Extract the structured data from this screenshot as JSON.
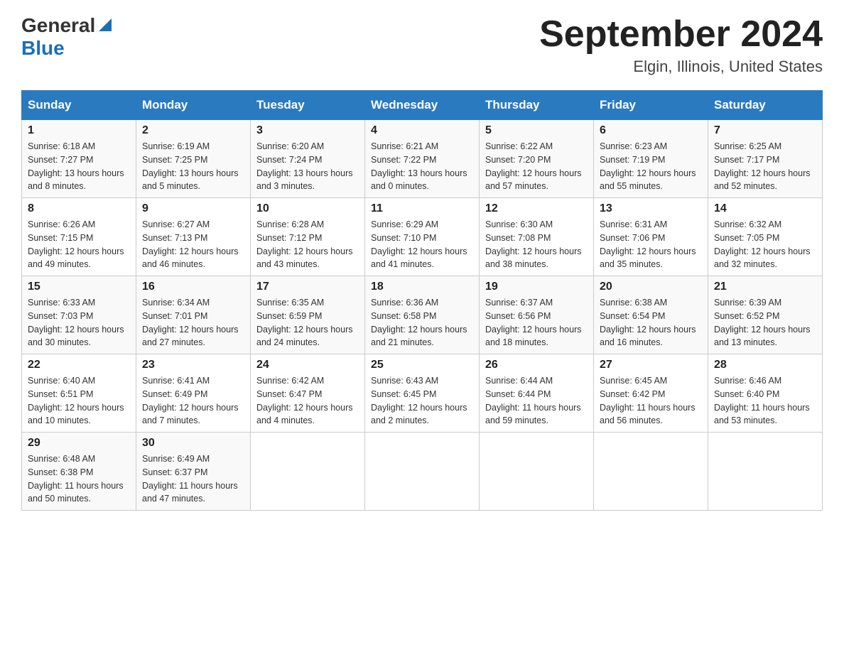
{
  "header": {
    "logo_general": "General",
    "logo_blue": "Blue",
    "title": "September 2024",
    "subtitle": "Elgin, Illinois, United States"
  },
  "days_of_week": [
    "Sunday",
    "Monday",
    "Tuesday",
    "Wednesday",
    "Thursday",
    "Friday",
    "Saturday"
  ],
  "weeks": [
    [
      {
        "day": "1",
        "sunrise": "6:18 AM",
        "sunset": "7:27 PM",
        "daylight": "13 hours and 8 minutes."
      },
      {
        "day": "2",
        "sunrise": "6:19 AM",
        "sunset": "7:25 PM",
        "daylight": "13 hours and 5 minutes."
      },
      {
        "day": "3",
        "sunrise": "6:20 AM",
        "sunset": "7:24 PM",
        "daylight": "13 hours and 3 minutes."
      },
      {
        "day": "4",
        "sunrise": "6:21 AM",
        "sunset": "7:22 PM",
        "daylight": "13 hours and 0 minutes."
      },
      {
        "day": "5",
        "sunrise": "6:22 AM",
        "sunset": "7:20 PM",
        "daylight": "12 hours and 57 minutes."
      },
      {
        "day": "6",
        "sunrise": "6:23 AM",
        "sunset": "7:19 PM",
        "daylight": "12 hours and 55 minutes."
      },
      {
        "day": "7",
        "sunrise": "6:25 AM",
        "sunset": "7:17 PM",
        "daylight": "12 hours and 52 minutes."
      }
    ],
    [
      {
        "day": "8",
        "sunrise": "6:26 AM",
        "sunset": "7:15 PM",
        "daylight": "12 hours and 49 minutes."
      },
      {
        "day": "9",
        "sunrise": "6:27 AM",
        "sunset": "7:13 PM",
        "daylight": "12 hours and 46 minutes."
      },
      {
        "day": "10",
        "sunrise": "6:28 AM",
        "sunset": "7:12 PM",
        "daylight": "12 hours and 43 minutes."
      },
      {
        "day": "11",
        "sunrise": "6:29 AM",
        "sunset": "7:10 PM",
        "daylight": "12 hours and 41 minutes."
      },
      {
        "day": "12",
        "sunrise": "6:30 AM",
        "sunset": "7:08 PM",
        "daylight": "12 hours and 38 minutes."
      },
      {
        "day": "13",
        "sunrise": "6:31 AM",
        "sunset": "7:06 PM",
        "daylight": "12 hours and 35 minutes."
      },
      {
        "day": "14",
        "sunrise": "6:32 AM",
        "sunset": "7:05 PM",
        "daylight": "12 hours and 32 minutes."
      }
    ],
    [
      {
        "day": "15",
        "sunrise": "6:33 AM",
        "sunset": "7:03 PM",
        "daylight": "12 hours and 30 minutes."
      },
      {
        "day": "16",
        "sunrise": "6:34 AM",
        "sunset": "7:01 PM",
        "daylight": "12 hours and 27 minutes."
      },
      {
        "day": "17",
        "sunrise": "6:35 AM",
        "sunset": "6:59 PM",
        "daylight": "12 hours and 24 minutes."
      },
      {
        "day": "18",
        "sunrise": "6:36 AM",
        "sunset": "6:58 PM",
        "daylight": "12 hours and 21 minutes."
      },
      {
        "day": "19",
        "sunrise": "6:37 AM",
        "sunset": "6:56 PM",
        "daylight": "12 hours and 18 minutes."
      },
      {
        "day": "20",
        "sunrise": "6:38 AM",
        "sunset": "6:54 PM",
        "daylight": "12 hours and 16 minutes."
      },
      {
        "day": "21",
        "sunrise": "6:39 AM",
        "sunset": "6:52 PM",
        "daylight": "12 hours and 13 minutes."
      }
    ],
    [
      {
        "day": "22",
        "sunrise": "6:40 AM",
        "sunset": "6:51 PM",
        "daylight": "12 hours and 10 minutes."
      },
      {
        "day": "23",
        "sunrise": "6:41 AM",
        "sunset": "6:49 PM",
        "daylight": "12 hours and 7 minutes."
      },
      {
        "day": "24",
        "sunrise": "6:42 AM",
        "sunset": "6:47 PM",
        "daylight": "12 hours and 4 minutes."
      },
      {
        "day": "25",
        "sunrise": "6:43 AM",
        "sunset": "6:45 PM",
        "daylight": "12 hours and 2 minutes."
      },
      {
        "day": "26",
        "sunrise": "6:44 AM",
        "sunset": "6:44 PM",
        "daylight": "11 hours and 59 minutes."
      },
      {
        "day": "27",
        "sunrise": "6:45 AM",
        "sunset": "6:42 PM",
        "daylight": "11 hours and 56 minutes."
      },
      {
        "day": "28",
        "sunrise": "6:46 AM",
        "sunset": "6:40 PM",
        "daylight": "11 hours and 53 minutes."
      }
    ],
    [
      {
        "day": "29",
        "sunrise": "6:48 AM",
        "sunset": "6:38 PM",
        "daylight": "11 hours and 50 minutes."
      },
      {
        "day": "30",
        "sunrise": "6:49 AM",
        "sunset": "6:37 PM",
        "daylight": "11 hours and 47 minutes."
      },
      null,
      null,
      null,
      null,
      null
    ]
  ],
  "labels": {
    "sunrise": "Sunrise:",
    "sunset": "Sunset:",
    "daylight": "Daylight:"
  }
}
